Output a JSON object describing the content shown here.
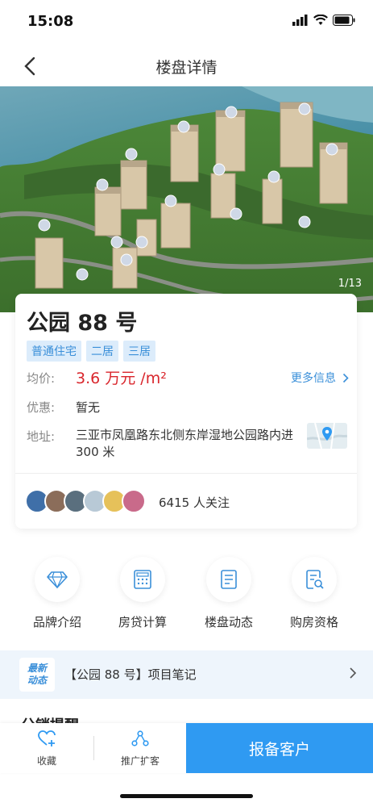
{
  "status_bar": {
    "time": "15:08"
  },
  "nav": {
    "title": "楼盘详情"
  },
  "hero": {
    "counter": "1/13"
  },
  "property": {
    "name": "公园 88 号",
    "tags": [
      "普通住宅",
      "二居",
      "三居"
    ],
    "price_label": "均价:",
    "price_value": "3.6 万元 /m²",
    "more_info": "更多信息",
    "discount_label": "优惠:",
    "discount_value": "暂无",
    "address_label": "地址:",
    "address_value": "三亚市凤凰路东北侧东岸湿地公园路内进 300 米",
    "followers": "6415 人关注"
  },
  "features": [
    {
      "label": "品牌介绍",
      "icon": "diamond-icon"
    },
    {
      "label": "房贷计算",
      "icon": "calculator-icon"
    },
    {
      "label": "楼盘动态",
      "icon": "document-icon"
    },
    {
      "label": "购房资格",
      "icon": "document-search-icon"
    }
  ],
  "news": {
    "badge_line1": "最新",
    "badge_line2": "动态",
    "text": "【公园 88 号】项目笔记"
  },
  "section_peek": "分销提醒",
  "bottom": {
    "favorite": "收藏",
    "promote": "推广扩客",
    "report": "报备客户"
  },
  "colors": {
    "accent": "#2f9af2",
    "price": "#d9262c",
    "tag_bg": "#dcecfb"
  }
}
